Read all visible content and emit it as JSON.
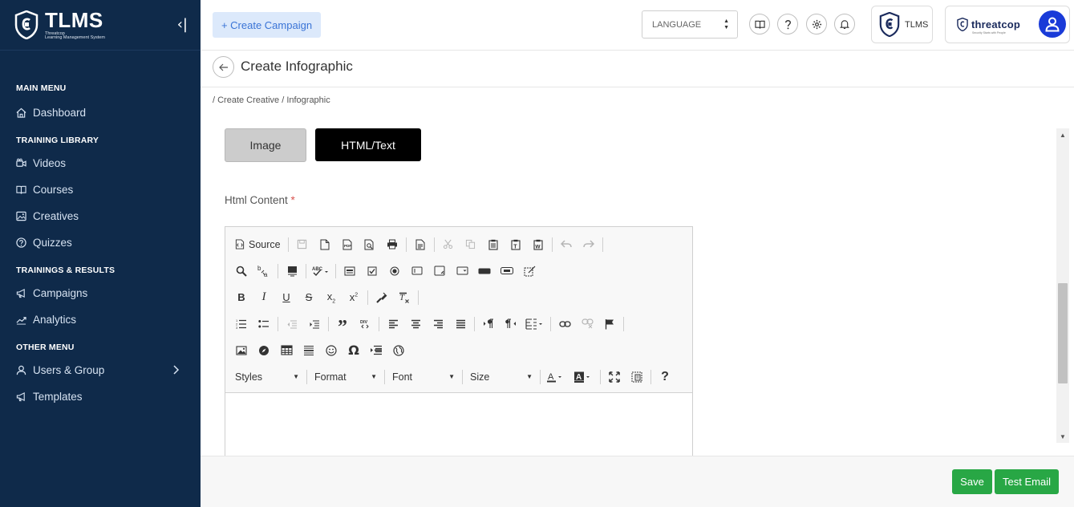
{
  "sidebar": {
    "brand_title": "TLMS",
    "brand_sub1": "Threatcop",
    "brand_sub2": "Learning Management System",
    "collapse_glyph": "‹|",
    "sections": {
      "main_menu": "MAIN MENU",
      "training_library": "TRAINING LIBRARY",
      "trainings_results": "TRAININGS & RESULTS",
      "other_menu": "OTHER MENU"
    },
    "items": {
      "dashboard": "Dashboard",
      "videos": "Videos",
      "courses": "Courses",
      "creatives": "Creatives",
      "quizzes": "Quizzes",
      "campaigns": "Campaigns",
      "analytics": "Analytics",
      "users_group": "Users & Group",
      "templates": "Templates"
    }
  },
  "header": {
    "create_campaign": "+ Create Campaign",
    "language": "LANGUAGE",
    "icons": [
      "book-icon",
      "help-icon",
      "settings-icon",
      "bell-icon"
    ],
    "tlms_label": "TLMS",
    "threatcop_word": "threatcop",
    "threatcop_tag": "Security Starts with People"
  },
  "page": {
    "title": "Create Infographic",
    "breadcrumb": "/ Create Creative / Infographic"
  },
  "form": {
    "tab_image": "Image",
    "tab_html": "HTML/Text",
    "label": "Html Content",
    "required_mark": "*"
  },
  "editor": {
    "source_label": "Source",
    "combo_styles": "Styles",
    "combo_format": "Format",
    "combo_font": "Font",
    "combo_size": "Size"
  },
  "footer": {
    "save": "Save",
    "test_email": "Test Email"
  },
  "colors": {
    "sidebar_bg": "#0f2a4a",
    "accent_green": "#28a745",
    "create_btn_bg": "#dce9fb",
    "avatar_blue": "#1a3bd8"
  }
}
